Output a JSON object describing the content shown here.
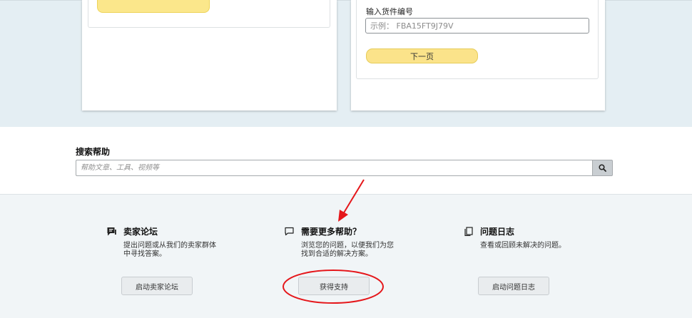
{
  "shipment": {
    "field_label": "输入货件编号",
    "placeholder": "示例： FBA15FT9J79V",
    "next_button": "下一页"
  },
  "search": {
    "title": "搜索帮助",
    "placeholder": "帮助文章、工具、视频等",
    "icon": "search-icon"
  },
  "help_columns": [
    {
      "icon": "forum-icon",
      "title": "卖家论坛",
      "desc_lines": [
        "提出问题或从我们的卖家群体",
        "中寻找答案。"
      ],
      "button": "启动卖家论坛"
    },
    {
      "icon": "chat-bubble-icon",
      "title": "需要更多帮助？",
      "desc_lines": [
        "浏览您的问题，以便我们为您",
        "找到合适的解决方案。"
      ],
      "button": "获得支持"
    },
    {
      "icon": "copy-log-icon",
      "title": "问题日志",
      "desc_lines": [
        "查看或回顾未解决的问题。"
      ],
      "button": "启动问题日志"
    }
  ],
  "annotation": {
    "color": "#e5171b"
  },
  "colors": {
    "band": "#e4eef3",
    "yellow_button": "#fbe38a",
    "footer_band": "#f1f5f7"
  }
}
